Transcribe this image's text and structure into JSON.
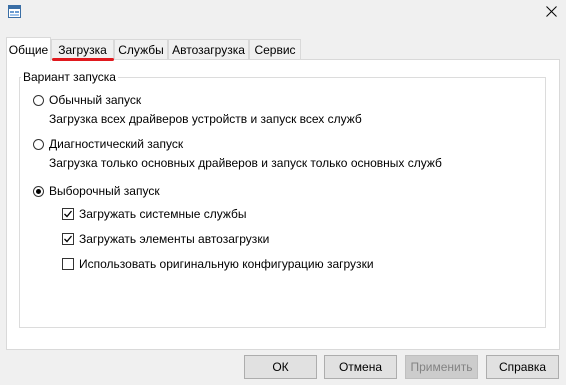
{
  "window": {
    "icon": "msconfig-icon",
    "close_icon": "close-icon"
  },
  "tabs": [
    {
      "label": "Общие",
      "active": true
    },
    {
      "label": "Загрузка",
      "active": false,
      "highlighted": true
    },
    {
      "label": "Службы",
      "active": false
    },
    {
      "label": "Автозагрузка",
      "active": false
    },
    {
      "label": "Сервис",
      "active": false
    }
  ],
  "highlight_color": "#e0191e",
  "startup": {
    "group_title": "Вариант запуска",
    "normal": {
      "label": "Обычный запуск",
      "description": "Загрузка всех драйверов устройств и запуск всех служб",
      "selected": false
    },
    "diagnostic": {
      "label": "Диагностический запуск",
      "description": "Загрузка только основных драйверов и запуск только основных служб",
      "selected": false
    },
    "selective": {
      "label": "Выборочный запуск",
      "selected": true,
      "options": [
        {
          "label": "Загружать системные службы",
          "checked": true
        },
        {
          "label": "Загружать элементы автозагрузки",
          "checked": true
        },
        {
          "label": "Использовать оригинальную конфигурацию загрузки",
          "checked": false
        }
      ]
    }
  },
  "buttons": {
    "ok": "ОК",
    "cancel": "Отмена",
    "apply": "Применить",
    "help": "Справка"
  }
}
